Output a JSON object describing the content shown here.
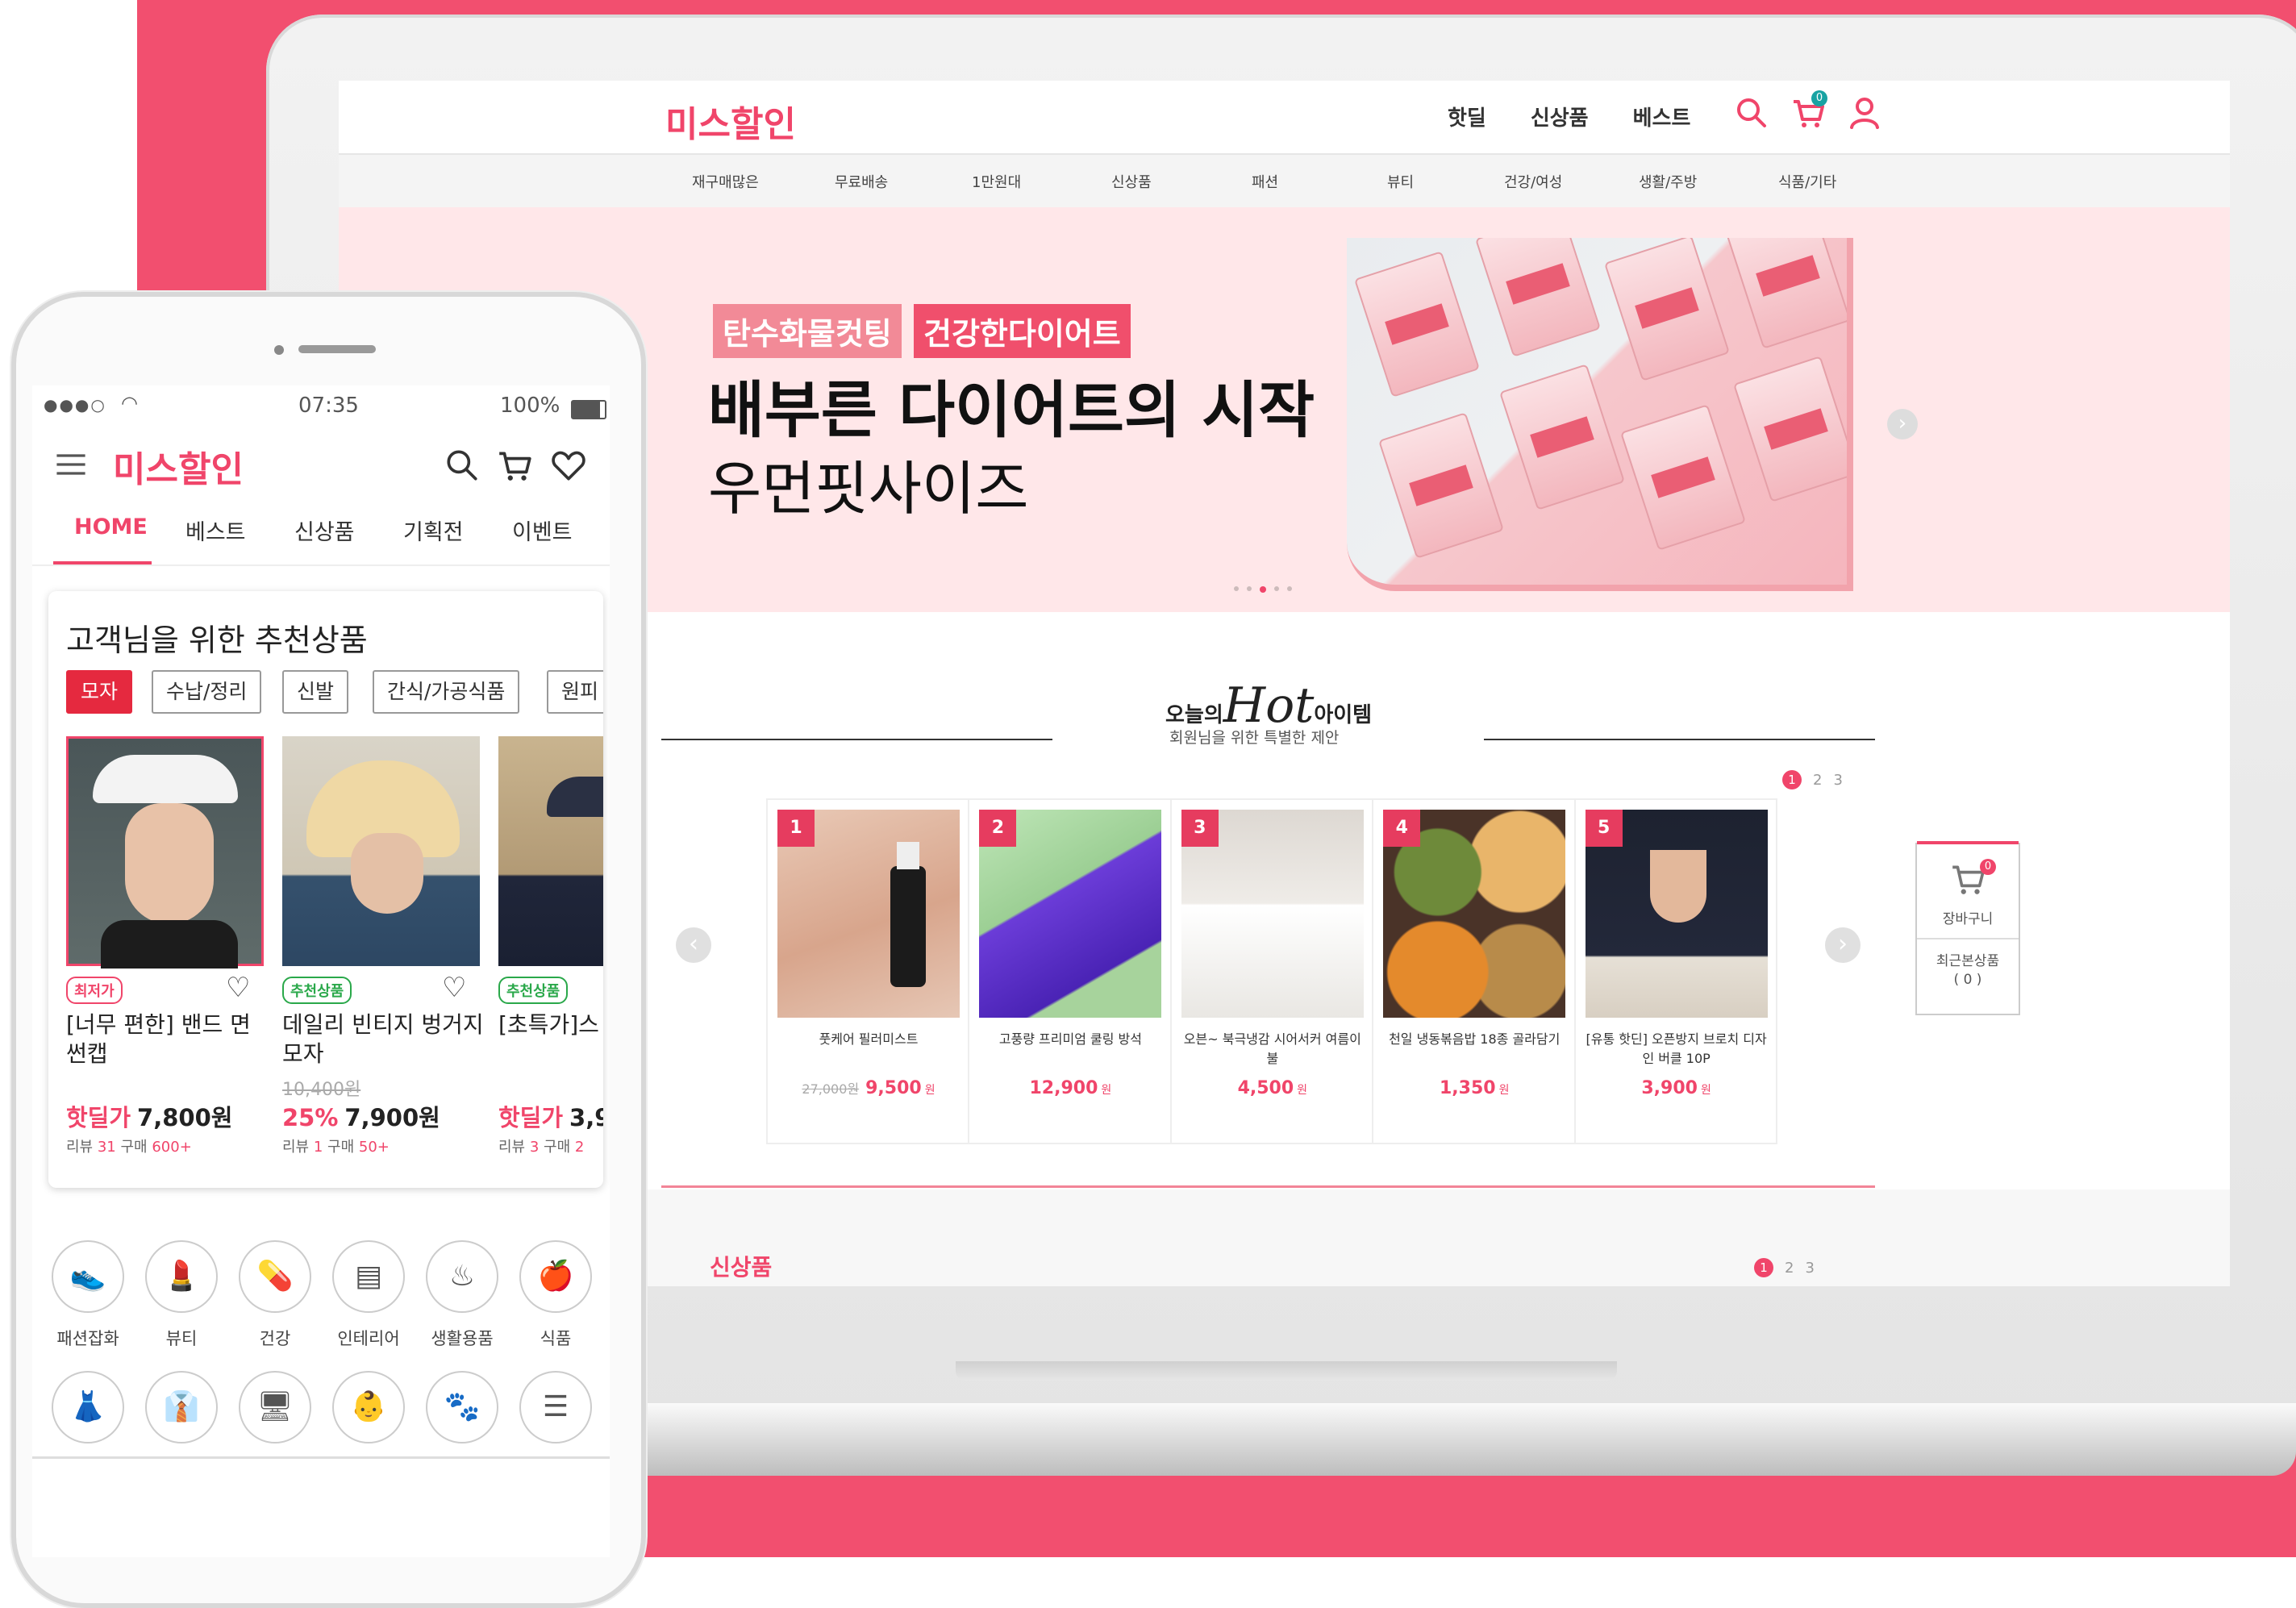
{
  "desktop": {
    "logo": "미스할인",
    "top_nav": [
      "핫딜",
      "신상품",
      "베스트"
    ],
    "cart_count": "0",
    "categories": [
      "재구매많은",
      "무료배송",
      "1만원대",
      "신상품",
      "패션",
      "뷰티",
      "건강/여성",
      "생활/주방",
      "식품/기타"
    ],
    "banner": {
      "badge1": "탄수화물컷팅",
      "badge2": "건강한다이어트",
      "title": "배부른 다이어트의 시작",
      "subtitle": "우먼핏사이즈",
      "product_label": "우먼핏 사이즈"
    },
    "hot": {
      "title_prefix": "오늘의",
      "title_big": "Hot",
      "title_suffix": "아이템",
      "subtitle": "회원님을 위한 특별한 제안",
      "pages": [
        "1",
        "2",
        "3"
      ],
      "items": [
        {
          "rank": "1",
          "name": "풋케어 필러미스트",
          "orig": "27,000원",
          "price": "9,500",
          "unit": "원"
        },
        {
          "rank": "2",
          "name": "고풍량 프리미엄 쿨링 방석",
          "orig": "",
          "price": "12,900",
          "unit": "원"
        },
        {
          "rank": "3",
          "name": "오븐~ 북극냉감 시어서커 여름이불",
          "orig": "",
          "price": "4,500",
          "unit": "원"
        },
        {
          "rank": "4",
          "name": "천일 냉동볶음밥 18종 골라담기",
          "orig": "",
          "price": "1,350",
          "unit": "원"
        },
        {
          "rank": "5",
          "name": "[유통 핫딘] 오픈방지 브로치 디자인 버클 10P",
          "orig": "",
          "price": "3,900",
          "unit": "원"
        }
      ]
    },
    "side_widget": {
      "cart": "장바구니",
      "cart_count": "0",
      "recent": "최근본상품",
      "recent_count": "( 0 )"
    },
    "new_title": "신상품",
    "new_pages": [
      "1",
      "2",
      "3"
    ]
  },
  "mobile": {
    "status": {
      "signal": "●●●○",
      "time": "07:35",
      "battery": "100%"
    },
    "logo": "미스할인",
    "tabs": [
      "HOME",
      "베스트",
      "신상품",
      "기획전",
      "이벤트"
    ],
    "reco_title": "고객님을 위한 추천상품",
    "chips": [
      "모자",
      "수납/정리",
      "신발",
      "간식/가공식품",
      "원피"
    ],
    "cards": [
      {
        "tag": "최저가",
        "name": "[너무 편한] 밴드 면 썬캡",
        "orig": "",
        "label": "핫딜가",
        "price": "7,800원",
        "review": "리뷰",
        "review_n": "31",
        "buy": "구매",
        "buy_n": "600+"
      },
      {
        "tag": "추천상품",
        "name": "데일리 빈티지 벙거지모자",
        "orig": "10,400원",
        "label": "25%",
        "price": "7,900원",
        "review": "리뷰",
        "review_n": "1",
        "buy": "구매",
        "buy_n": "50+"
      },
      {
        "tag": "추천상품",
        "name": "[초특가]스 썬캡 남녀",
        "orig": "",
        "label": "핫딜가",
        "price": "3,9",
        "review": "리뷰",
        "review_n": "3",
        "buy": "구매",
        "buy_n": "2"
      }
    ],
    "categories": [
      "패션잡화",
      "뷰티",
      "건강",
      "인테리어",
      "생활용품",
      "식품"
    ]
  },
  "colors": {
    "brand": "#f0456a",
    "background": "#f24f6f"
  }
}
